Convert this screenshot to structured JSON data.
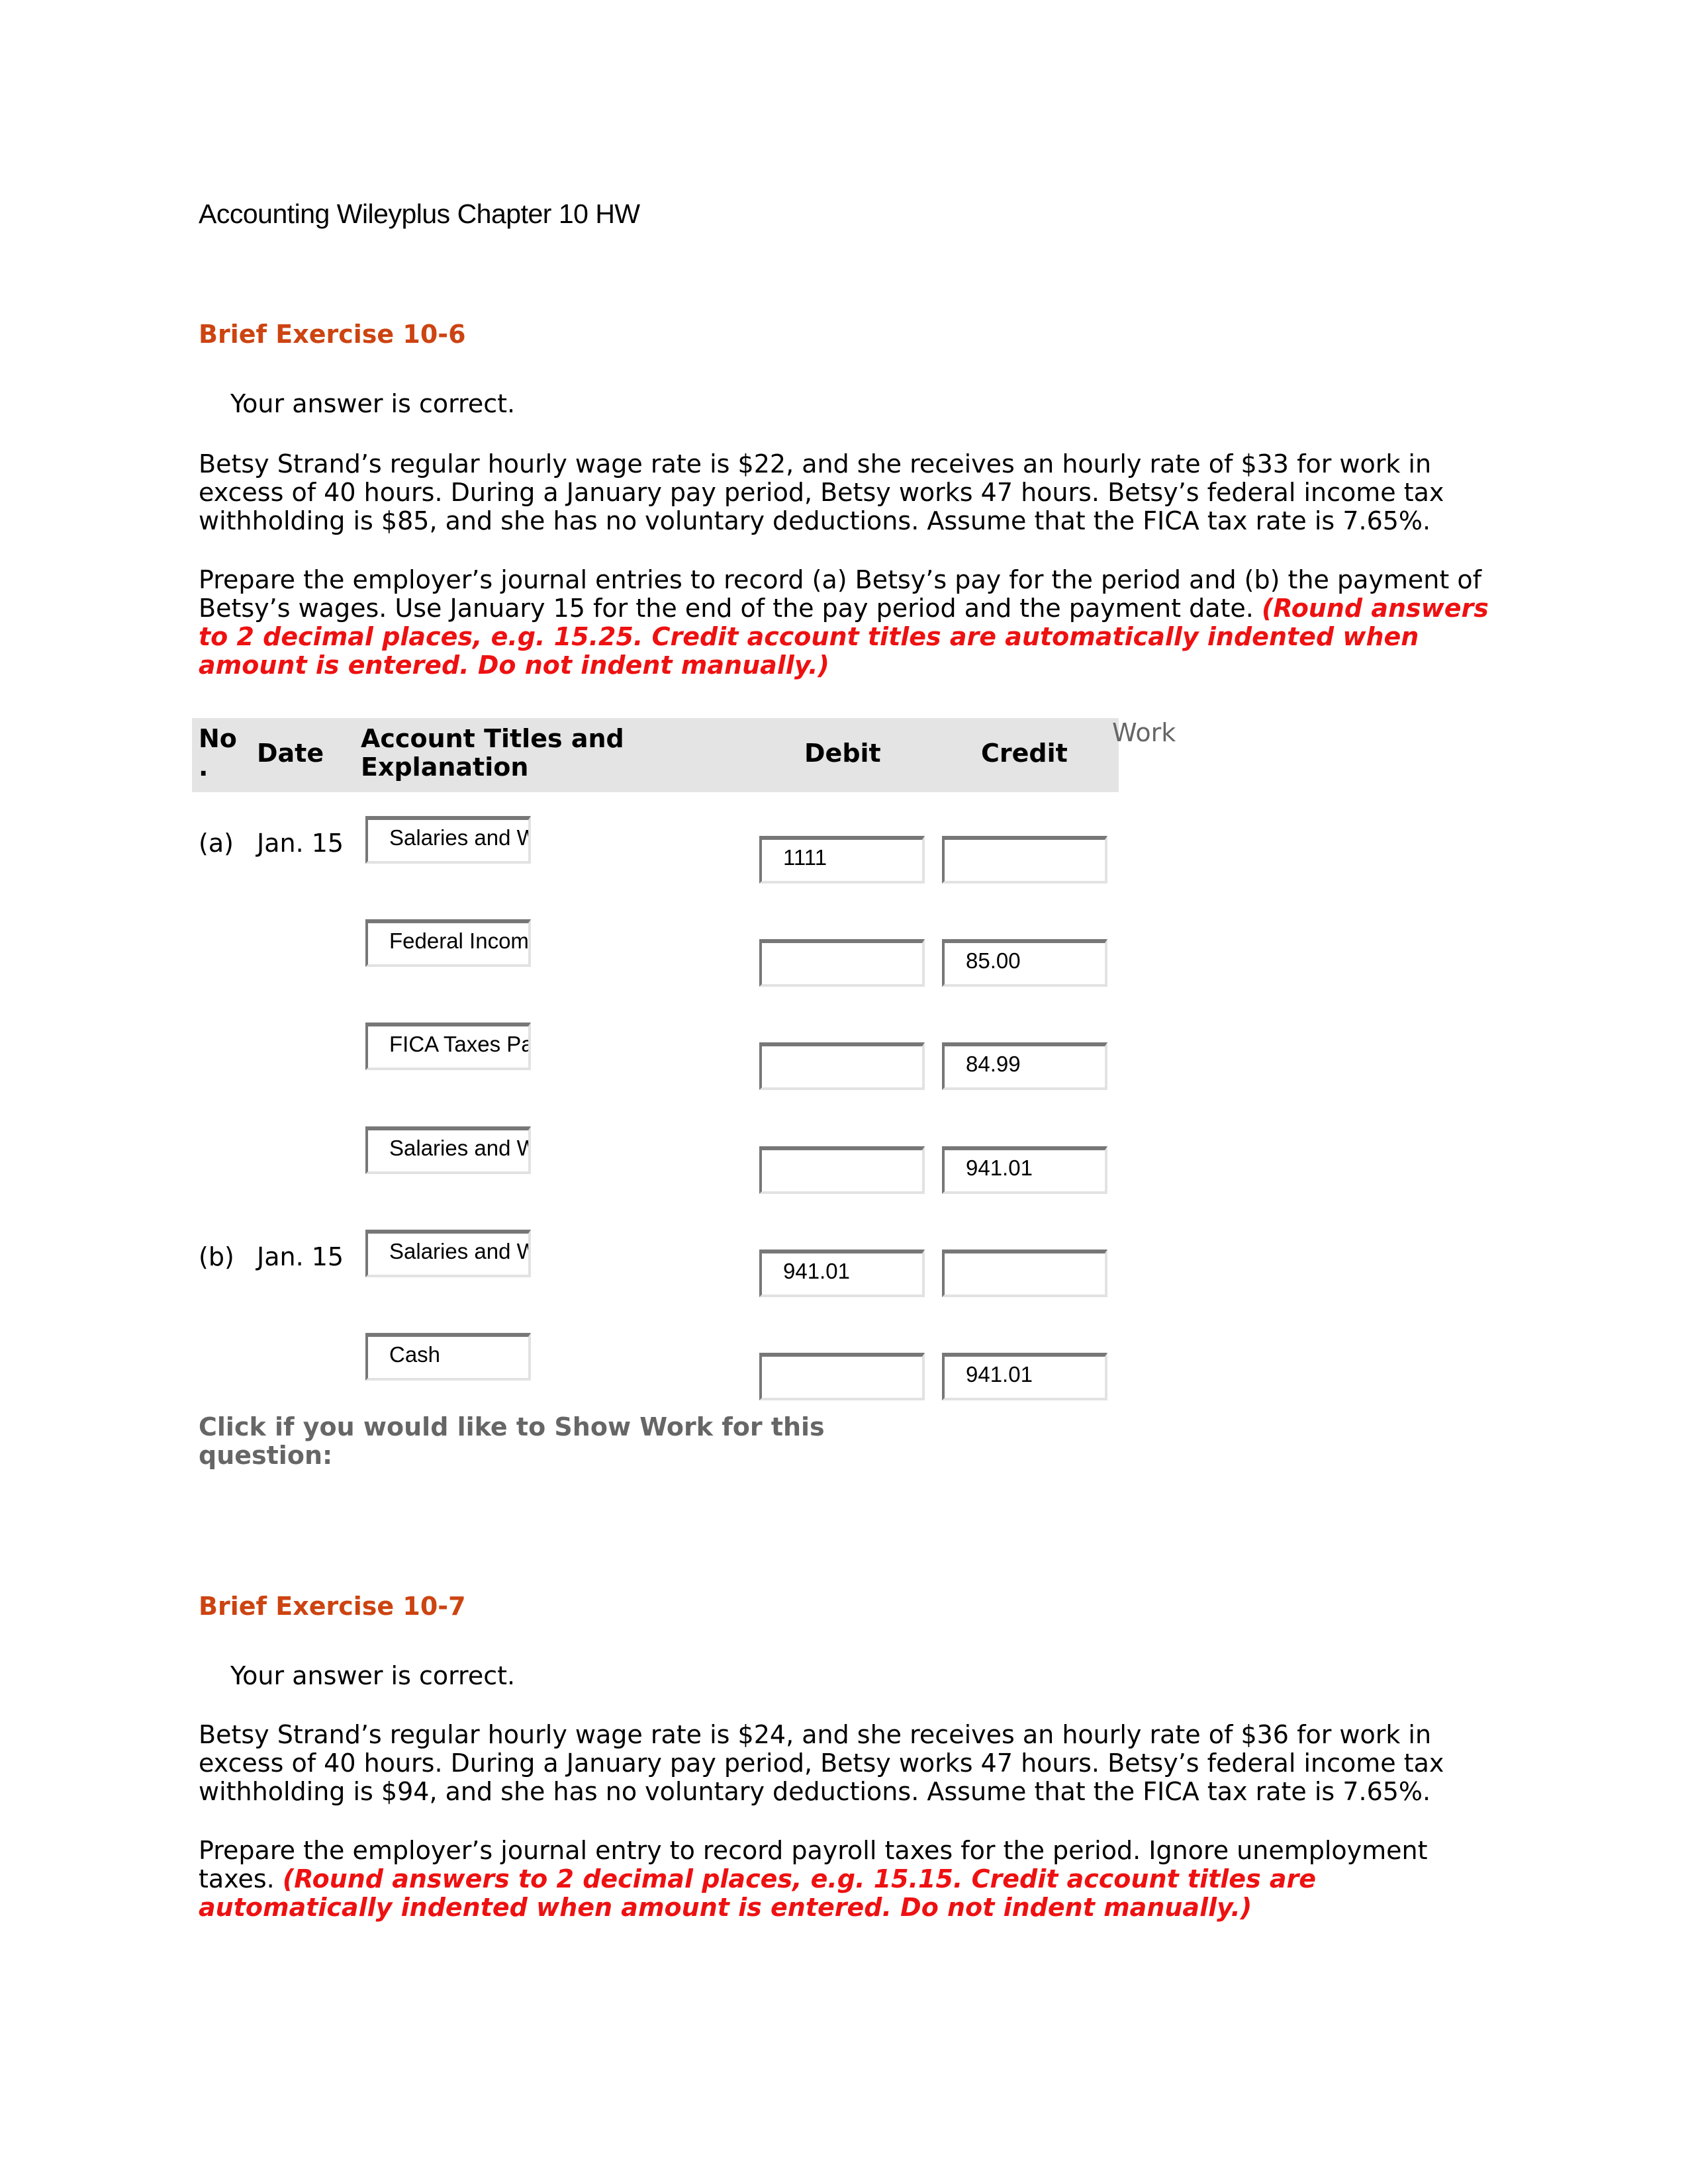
{
  "document": {
    "title": "Accounting Wileyplus Chapter 10 HW"
  },
  "exercise_10_6": {
    "title": "Brief Exercise 10-6",
    "status": "Your answer is correct.",
    "problem": "Betsy Strand’s regular hourly wage rate is $22, and she receives an hourly rate of $33 for work in excess of 40 hours. During a January pay period, Betsy works 47 hours. Betsy’s federal income tax withholding is $85, and she has no voluntary deductions. Assume that the FICA tax rate is 7.65%.",
    "instructions": "Prepare the employer’s journal entries to record (a) Betsy’s pay for the period and (b) the payment of Betsy’s wages. Use January 15 for the end of the pay period and the payment date.",
    "instructions_note": "(Round answers to 2 decimal places, e.g. 15.25. Credit account titles are automatically indented when amount is entered. Do not indent manually.)",
    "overflow_fragment": "Work",
    "table": {
      "headers": {
        "no": "No .",
        "date": "Date",
        "account": "Account Titles and Explanation",
        "debit": "Debit",
        "credit": "Credit"
      },
      "rows": [
        {
          "no": "(a)",
          "date": "Jan. 15",
          "account": "Salaries and W",
          "debit": "1111",
          "credit": ""
        },
        {
          "no": "",
          "date": "",
          "account": "Federal Incom",
          "debit": "",
          "credit": "85.00"
        },
        {
          "no": "",
          "date": "",
          "account": "FICA Taxes Pa",
          "debit": "",
          "credit": "84.99"
        },
        {
          "no": "",
          "date": "",
          "account": "Salaries and W",
          "debit": "",
          "credit": "941.01"
        },
        {
          "no": "(b)",
          "date": "Jan. 15",
          "account": "Salaries and W",
          "debit": "941.01",
          "credit": ""
        },
        {
          "no": "",
          "date": "",
          "account": "Cash",
          "debit": "",
          "credit": "941.01"
        }
      ]
    },
    "show_work": "Click if you would like to Show Work for this question:"
  },
  "exercise_10_7": {
    "title": "Brief Exercise 10-7",
    "status": "Your answer is correct.",
    "problem": "Betsy Strand’s regular hourly wage rate is $24, and she receives an hourly rate of $36 for work in excess of 40 hours. During a January pay period, Betsy works 47 hours. Betsy’s federal income tax withholding is $94, and she has no voluntary deductions. Assume that the FICA tax rate is 7.65%.",
    "instructions": "Prepare the employer’s journal entry to record payroll taxes for the period. Ignore unemployment taxes.",
    "instructions_note": "(Round answers to 2 decimal places, e.g. 15.15. Credit account titles are automatically indented when amount is entered. Do not indent manually.)"
  }
}
